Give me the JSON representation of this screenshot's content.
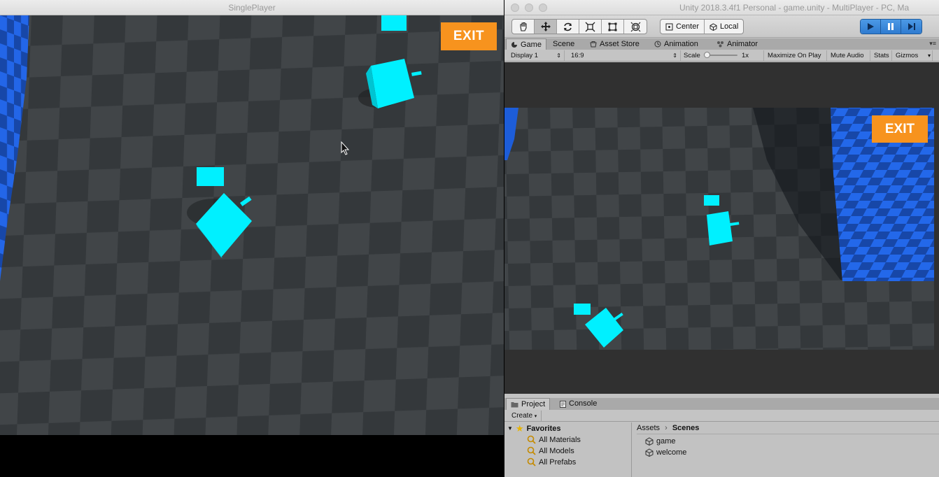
{
  "left_window": {
    "title": "SinglePlayer",
    "exit_label": "EXIT"
  },
  "right_window": {
    "title": "Unity 2018.3.4f1 Personal - game.unity - MultiPlayer - PC, Ma",
    "toolbar": {
      "tools": [
        "hand-icon",
        "move-icon",
        "rotate-icon",
        "scale-icon",
        "rect-icon",
        "transform-icon"
      ],
      "active_tool": "move-icon",
      "pivot_label": "Center",
      "space_label": "Local"
    },
    "tabs": [
      {
        "label": "Game",
        "icon": "game-icon",
        "active": true
      },
      {
        "label": "Scene",
        "icon": "",
        "active": false
      },
      {
        "label": "Asset Store",
        "icon": "store-icon",
        "active": false
      },
      {
        "label": "Animation",
        "icon": "animation-icon",
        "active": false
      },
      {
        "label": "Animator",
        "icon": "animator-icon",
        "active": false
      }
    ],
    "game_bar": {
      "display": "Display 1",
      "aspect": "16:9",
      "scale_label": "Scale",
      "scale_value": "1x",
      "maximize": "Maximize On Play",
      "mute": "Mute Audio",
      "stats": "Stats",
      "gizmos": "Gizmos"
    },
    "exit_label": "EXIT",
    "project_tabs": [
      {
        "label": "Project",
        "active": true
      },
      {
        "label": "Console",
        "active": false
      }
    ],
    "create_label": "Create",
    "favorites": {
      "label": "Favorites",
      "items": [
        "All Materials",
        "All Models",
        "All Prefabs"
      ]
    },
    "breadcrumb": {
      "root": "Assets",
      "current": "Scenes"
    },
    "scenes": [
      "game",
      "welcome"
    ]
  },
  "colors": {
    "accent_exit": "#f7931e",
    "player_cube": "#00f0ff",
    "wall_blue": "#1d5dd9",
    "play_blue": "#3a88dc"
  }
}
